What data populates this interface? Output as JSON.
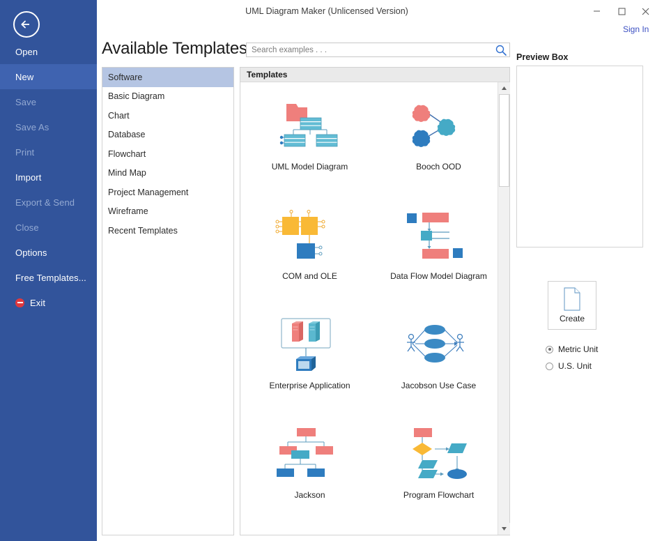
{
  "window": {
    "title": "UML Diagram Maker (Unlicensed Version)",
    "minimize_label": "minimize",
    "maximize_label": "maximize",
    "close_label": "close",
    "sign_in_label": "Sign In"
  },
  "sidebar": {
    "back_icon": "back-arrow-icon",
    "accent_color": "#32549b",
    "active_color": "#3f63b0",
    "items": [
      {
        "label": "Open",
        "state": "enabled"
      },
      {
        "label": "New",
        "state": "active"
      },
      {
        "label": "Save",
        "state": "disabled"
      },
      {
        "label": "Save As",
        "state": "disabled"
      },
      {
        "label": "Print",
        "state": "disabled"
      },
      {
        "label": "Import",
        "state": "enabled"
      },
      {
        "label": "Export & Send",
        "state": "disabled"
      },
      {
        "label": "Close",
        "state": "disabled"
      },
      {
        "label": "Options",
        "state": "enabled"
      },
      {
        "label": "Free Templates...",
        "state": "enabled"
      },
      {
        "label": "Exit",
        "state": "enabled",
        "icon": "exit-icon"
      }
    ]
  },
  "header": {
    "page_title": "Available Templates"
  },
  "search": {
    "placeholder": "Search examples . . .",
    "value": "",
    "icon": "search-icon"
  },
  "categories": {
    "selected": "Software",
    "items": [
      "Software",
      "Basic Diagram",
      "Chart",
      "Database",
      "Flowchart",
      "Mind Map",
      "Project Management",
      "Wireframe",
      "Recent Templates"
    ]
  },
  "templates": {
    "header": "Templates",
    "scrollbar": {
      "up_icon": "scroll-up-icon",
      "down_icon": "scroll-down-icon",
      "thumb_position_percent": 0
    },
    "items": [
      {
        "label": "UML Model Diagram",
        "icon": "uml-model-diagram-thumb"
      },
      {
        "label": "Booch OOD",
        "icon": "booch-ood-thumb"
      },
      {
        "label": "COM and OLE",
        "icon": "com-and-ole-thumb"
      },
      {
        "label": "Data Flow Model Diagram",
        "icon": "data-flow-model-diagram-thumb"
      },
      {
        "label": "Enterprise Application",
        "icon": "enterprise-application-thumb"
      },
      {
        "label": "Jacobson Use Case",
        "icon": "jacobson-use-case-thumb"
      },
      {
        "label": "Jackson",
        "icon": "jackson-thumb"
      },
      {
        "label": "Program Flowchart",
        "icon": "program-flowchart-thumb"
      }
    ]
  },
  "preview": {
    "label": "Preview Box",
    "content": ""
  },
  "create": {
    "label": "Create",
    "icon": "new-document-icon"
  },
  "units": {
    "selected": "Metric Unit",
    "options": [
      {
        "label": "Metric Unit",
        "selected": true
      },
      {
        "label": "U.S. Unit",
        "selected": false
      }
    ]
  },
  "colors": {
    "sidebar_blue": "#32549b",
    "link_blue": "#3b4fc2",
    "selection_blue": "#b5c5e3",
    "shape_red": "#ee7b78",
    "shape_teal": "#4fa9c4",
    "shape_blue": "#2e7cbf",
    "shape_orange": "#f6b53a"
  }
}
